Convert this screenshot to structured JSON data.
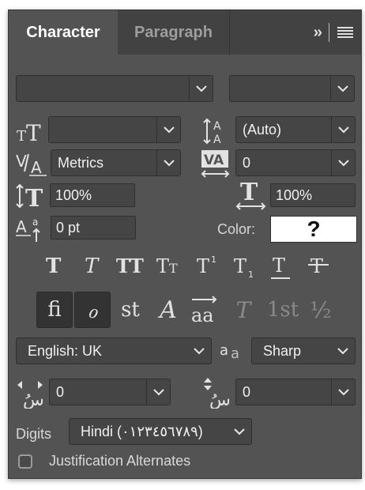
{
  "tabs": {
    "character": "Character",
    "paragraph": "Paragraph"
  },
  "font_family": {
    "value": ""
  },
  "font_style": {
    "value": ""
  },
  "font_size": {
    "value": ""
  },
  "leading": {
    "value": "(Auto)"
  },
  "kerning": {
    "value": "Metrics"
  },
  "tracking": {
    "value": "0"
  },
  "vertical_scale": {
    "value": "100%"
  },
  "horizontal_scale": {
    "value": "100%"
  },
  "baseline_shift": {
    "value": "0 pt"
  },
  "color": {
    "label": "Color:",
    "value": "?"
  },
  "type_styles": [
    "T",
    "T",
    "TT",
    "Tt",
    "T¹",
    "T₁",
    "T",
    "T"
  ],
  "opentype": [
    "fi",
    "ℴ",
    "st",
    "A",
    "aa",
    "T",
    "1st",
    "½"
  ],
  "language": {
    "value": "English: UK"
  },
  "antialias": {
    "icon_text": "aa",
    "value": "Sharp"
  },
  "diacritic_h": {
    "value": "0"
  },
  "diacritic_v": {
    "value": "0"
  },
  "digits": {
    "label": "Digits",
    "value": "Hindi (٠١٢٣٤٥٦٧٨٩)"
  },
  "justification": {
    "label": "Justification Alternates"
  }
}
